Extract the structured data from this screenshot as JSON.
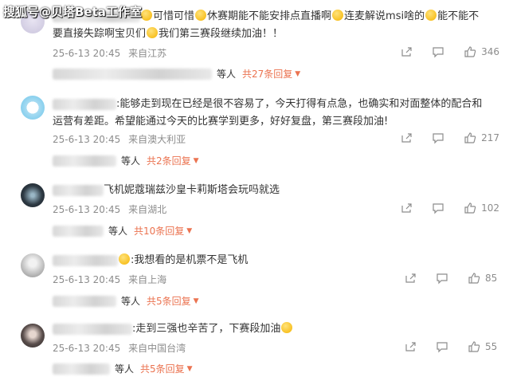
{
  "watermark": "搜狐号@贝塔Beta工作室",
  "comments": [
    {
      "text_parts": [
        "可惜可惜",
        "休赛期能不能安排点直播啊",
        "连麦解说msi啥的",
        "能不能不要直接失踪啊宝贝们",
        "我们第三赛段继续加油！！"
      ],
      "time": "25-6-13 20:45",
      "location": "来自江苏",
      "likes": "346",
      "reply_who": "等人",
      "reply_count": "共27条回复"
    },
    {
      "text": ":能够走到现在已经是很不容易了，今天打得有点急，也确实和对面整体的配合和运营有差距。希望能通过今天的比赛学到更多，好好复盘，第三赛段加油!",
      "time": "25-6-13 20:45",
      "location": "来自澳大利亚",
      "likes": "217",
      "reply_who": "等人",
      "reply_count": "共2条回复"
    },
    {
      "text": "飞机妮蔻瑞兹沙皇卡莉斯塔会玩吗就选",
      "time": "25-6-13 20:45",
      "location": "来自湖北",
      "likes": "102",
      "reply_who": "等人",
      "reply_count": "共10条回复"
    },
    {
      "text": ":我想看的是机票不是飞机",
      "time": "25-6-13 20:45",
      "location": "来自上海",
      "likes": "85",
      "reply_who": "等人",
      "reply_count": "共5条回复"
    },
    {
      "text": ":走到三强也辛苦了，下赛段加油",
      "time": "25-6-13 20:45",
      "location": "来自中国台湾",
      "likes": "55",
      "reply_who": "等人",
      "reply_count": "共5条回复"
    }
  ],
  "colors": {
    "link": "#eb7350",
    "meta": "#8c8c8c",
    "text": "#333333"
  },
  "icons": {
    "share": "share-icon",
    "comment": "comment-icon",
    "like": "like-icon"
  }
}
